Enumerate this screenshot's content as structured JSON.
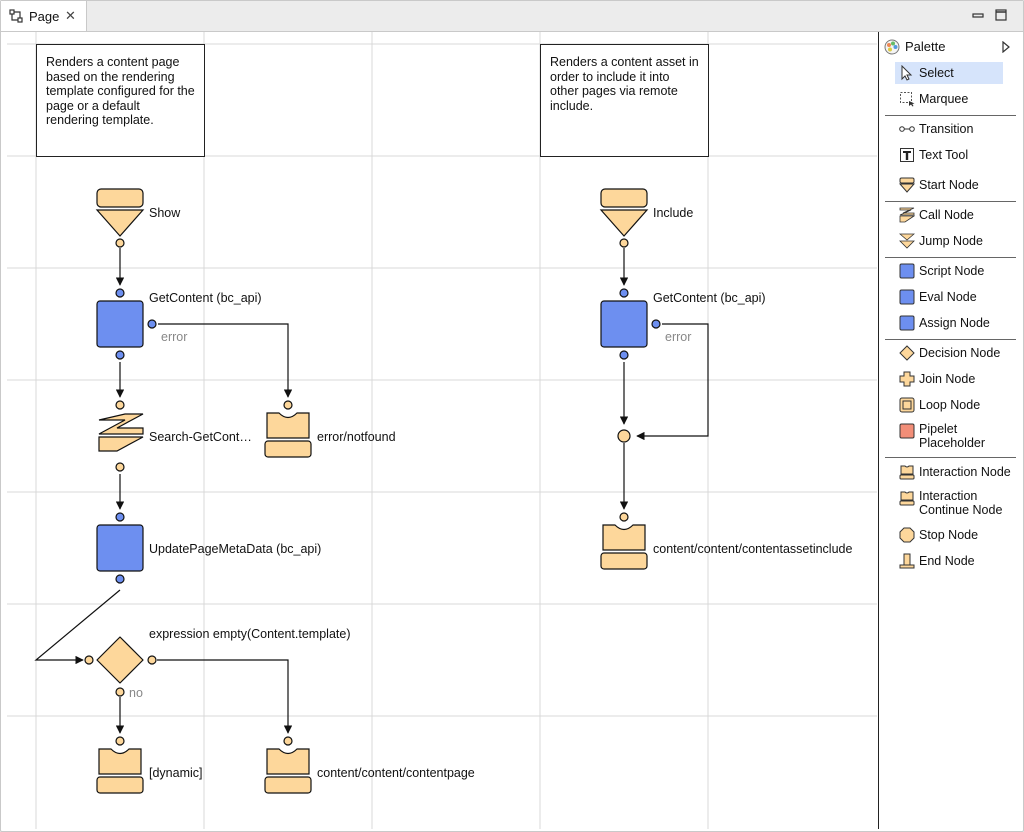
{
  "tab": {
    "title": "Page"
  },
  "notes": {
    "left": "Renders a content page based on the rendering template configured for the page or a default rendering template.",
    "right": "Renders a content asset in order to include it into other pages via remote include."
  },
  "nodes": {
    "show": "Show",
    "getcontent_left": "GetContent (bc_api)",
    "error_left": "error",
    "search": "Search-GetCont…",
    "error_notfound": "error/notfound",
    "update_meta": "UpdatePageMetaData (bc_api)",
    "decision": "expression empty(Content.template)",
    "no_label": "no",
    "dynamic": "[dynamic]",
    "contentpage": "content/content/contentpage",
    "include": "Include",
    "getcontent_right": "GetContent (bc_api)",
    "error_right": "error",
    "contentassetinclude": "content/content/contentassetinclude"
  },
  "palette": {
    "title": "Palette",
    "items": [
      {
        "label": "Select",
        "icon": "arrow-cursor-icon",
        "selected": true
      },
      {
        "label": "Marquee",
        "icon": "marquee-icon"
      },
      {
        "label": "Transition",
        "icon": "transition-icon"
      },
      {
        "label": "Text Tool",
        "icon": "text-tool-icon"
      },
      {
        "label": "Start Node",
        "icon": "start-node-icon"
      },
      {
        "label": "Call Node",
        "icon": "call-node-icon"
      },
      {
        "label": "Jump Node",
        "icon": "jump-node-icon"
      },
      {
        "label": "Script Node",
        "icon": "script-node-icon"
      },
      {
        "label": "Eval Node",
        "icon": "eval-node-icon"
      },
      {
        "label": "Assign Node",
        "icon": "assign-node-icon"
      },
      {
        "label": "Decision Node",
        "icon": "decision-node-icon"
      },
      {
        "label": "Join Node",
        "icon": "join-node-icon"
      },
      {
        "label": "Loop Node",
        "icon": "loop-node-icon"
      },
      {
        "label": "Pipelet\nPlaceholder",
        "line1": "Pipelet",
        "line2": "Placeholder",
        "icon": "pipelet-placeholder-icon"
      },
      {
        "label": "Interaction Node",
        "icon": "interaction-node-icon"
      },
      {
        "label": "Interaction\nContinue Node",
        "line1": "Interaction",
        "line2": "Continue Node",
        "icon": "interaction-continue-node-icon"
      },
      {
        "label": "Stop Node",
        "icon": "stop-node-icon"
      },
      {
        "label": "End Node",
        "icon": "end-node-icon"
      }
    ]
  },
  "colors": {
    "orange_fill": "#fdd79b",
    "blue_fill": "#6d8ff0",
    "grid": "#d9d9d9",
    "selection": "#d6e4fb",
    "pipelet": "#f28e78"
  }
}
